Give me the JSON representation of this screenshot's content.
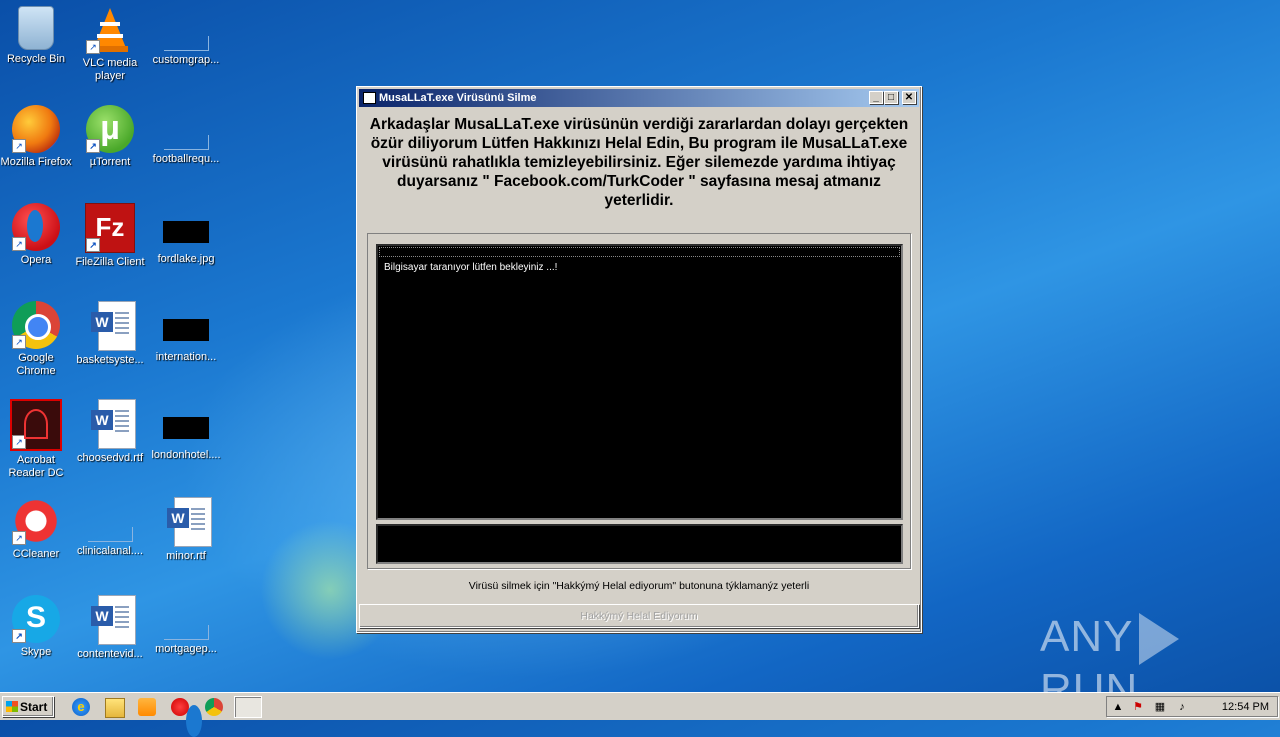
{
  "desktop": {
    "icons": [
      {
        "label": "Recycle Bin",
        "icon": "recycle-bin-icon"
      },
      {
        "label": "VLC media player",
        "icon": "vlc-icon"
      },
      {
        "label": "customgrap...",
        "icon": "blank-file-icon"
      },
      {
        "label": "Mozilla Firefox",
        "icon": "firefox-icon"
      },
      {
        "label": "µTorrent",
        "icon": "utorrent-icon"
      },
      {
        "label": "footballrequ...",
        "icon": "blank-file-icon"
      },
      {
        "label": "Opera",
        "icon": "opera-icon"
      },
      {
        "label": "FileZilla Client",
        "icon": "filezilla-icon"
      },
      {
        "label": "fordlake.jpg",
        "icon": "image-file-icon"
      },
      {
        "label": "Google Chrome",
        "icon": "chrome-icon"
      },
      {
        "label": "basketsyste...",
        "icon": "word-doc-icon"
      },
      {
        "label": "internation...",
        "icon": "image-file-icon"
      },
      {
        "label": "Acrobat Reader DC",
        "icon": "acrobat-icon"
      },
      {
        "label": "choosedvd.rtf",
        "icon": "word-doc-icon"
      },
      {
        "label": "londonhotel....",
        "icon": "image-file-icon"
      },
      {
        "label": "CCleaner",
        "icon": "ccleaner-icon"
      },
      {
        "label": "clinicalanal....",
        "icon": "blank-file-icon"
      },
      {
        "label": "minor.rtf",
        "icon": "word-doc-icon"
      },
      {
        "label": "Skype",
        "icon": "skype-icon"
      },
      {
        "label": "contentevid...",
        "icon": "word-doc-icon"
      },
      {
        "label": "mortgagep...",
        "icon": "blank-file-icon"
      }
    ]
  },
  "window": {
    "title": "MusaLLaT.exe Virüsünü Silme",
    "message": "Arkadaşlar MusaLLaT.exe virüsünün verdiği zararlardan dolayı gerçekten özür diliyorum Lütfen Hakkınızı Helal Edin,  Bu program ile MusaLLaT.exe virüsünü rahatlıkla temizleyebilirsiniz.  Eğer silemezde yardıma ihtiyaç duyarsanız \" Facebook.com/TurkCoder \" sayfasına mesaj atmanız yeterlidir.",
    "console_line": "Bilgisayar taranıyor lütfen bekleyiniz ...!",
    "hint": "Virüsü silmek için \"Hakkýmý Helal ediyorum\" butonuna týklamanýz yeterli",
    "button_label": "Hakkýmý Helal Ediyorum",
    "controls": {
      "minimize": "_",
      "maximize": "□",
      "close": "✕"
    }
  },
  "watermark": {
    "left": "ANY",
    "right": "RUN"
  },
  "taskbar": {
    "start_label": "Start",
    "clock": "12:54 PM",
    "tray_expand": "▲"
  }
}
